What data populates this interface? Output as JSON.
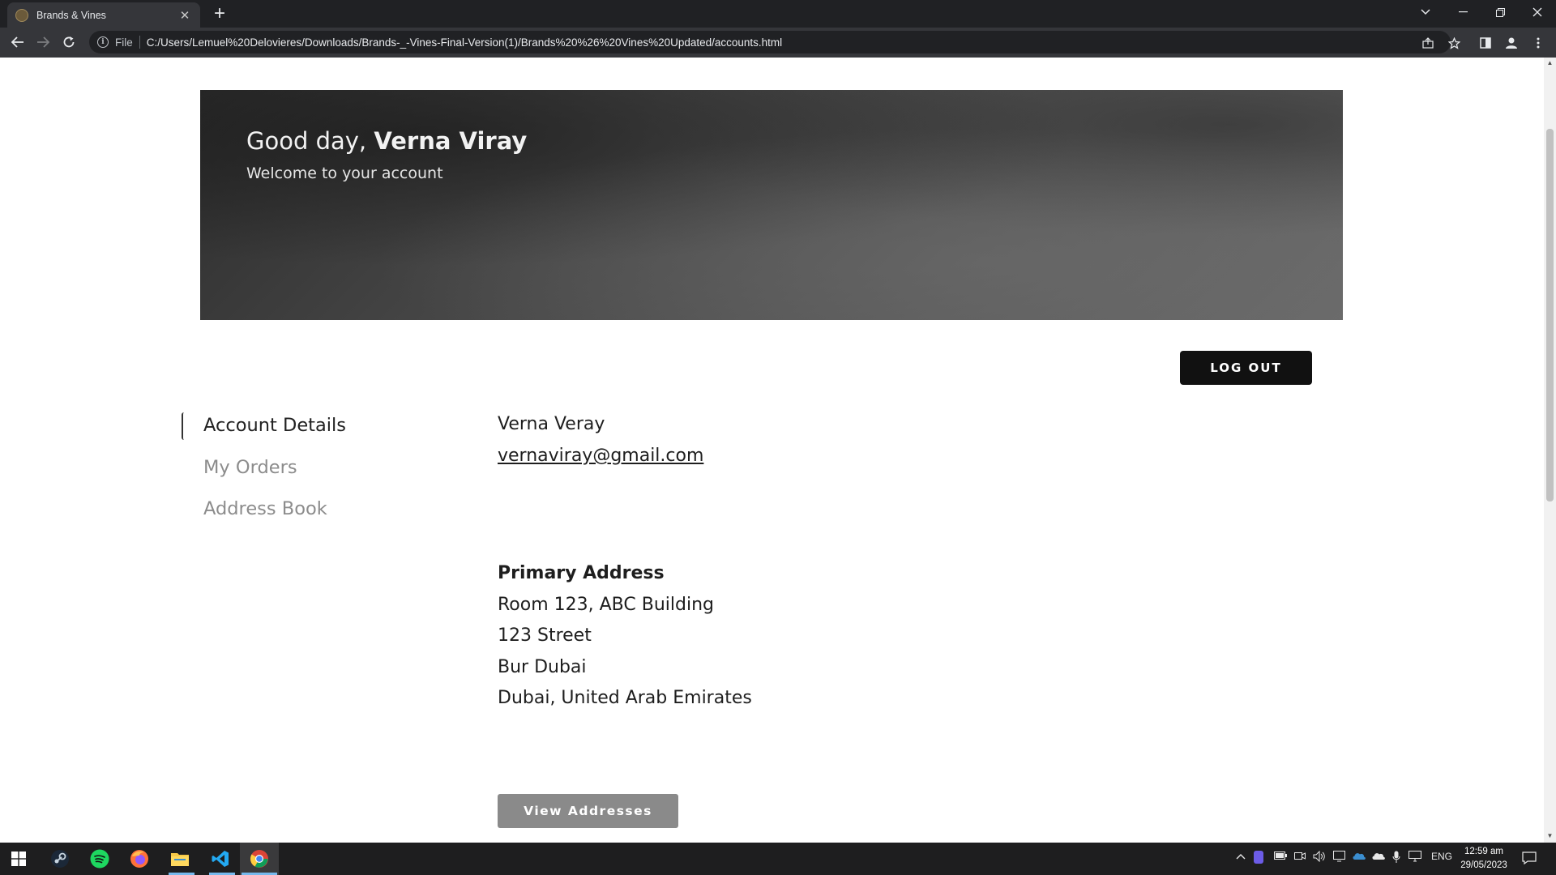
{
  "browser": {
    "tab_title": "Brands & Vines",
    "tab_close": "✕",
    "new_tab": "+",
    "scheme_label": "File",
    "url": "C:/Users/Lemuel%20Delovieres/Downloads/Brands-_-Vines-Final-Version(1)/Brands%20%26%20Vines%20Updated/accounts.html"
  },
  "hero": {
    "greeting_prefix": "Good day, ",
    "user_name": "Verna Viray",
    "welcome": "Welcome to your account"
  },
  "actions": {
    "logout_label": "LOG OUT"
  },
  "sidenav": {
    "items": [
      {
        "label": "Account Details",
        "active": true
      },
      {
        "label": "My Orders",
        "active": false
      },
      {
        "label": "Address Book",
        "active": false
      }
    ]
  },
  "account": {
    "name": "Verna Veray",
    "email": "vernaviray@gmail.com"
  },
  "address": {
    "heading": "Primary Address",
    "lines": [
      "Room 123, ABC Building",
      "123 Street",
      "Bur Dubai",
      "Dubai, United Arab Emirates"
    ],
    "view_button": "View Addresses"
  },
  "taskbar": {
    "apps": [
      "windows-start",
      "steam",
      "spotify",
      "firefox",
      "file-explorer",
      "vscode",
      "chrome"
    ],
    "language": "ENG",
    "time": "12:59 am",
    "date": "29/05/2023"
  },
  "colors": {
    "logout_bg": "#111111",
    "view_button_bg": "#8a8a8a",
    "chrome_dark": "#202124"
  }
}
